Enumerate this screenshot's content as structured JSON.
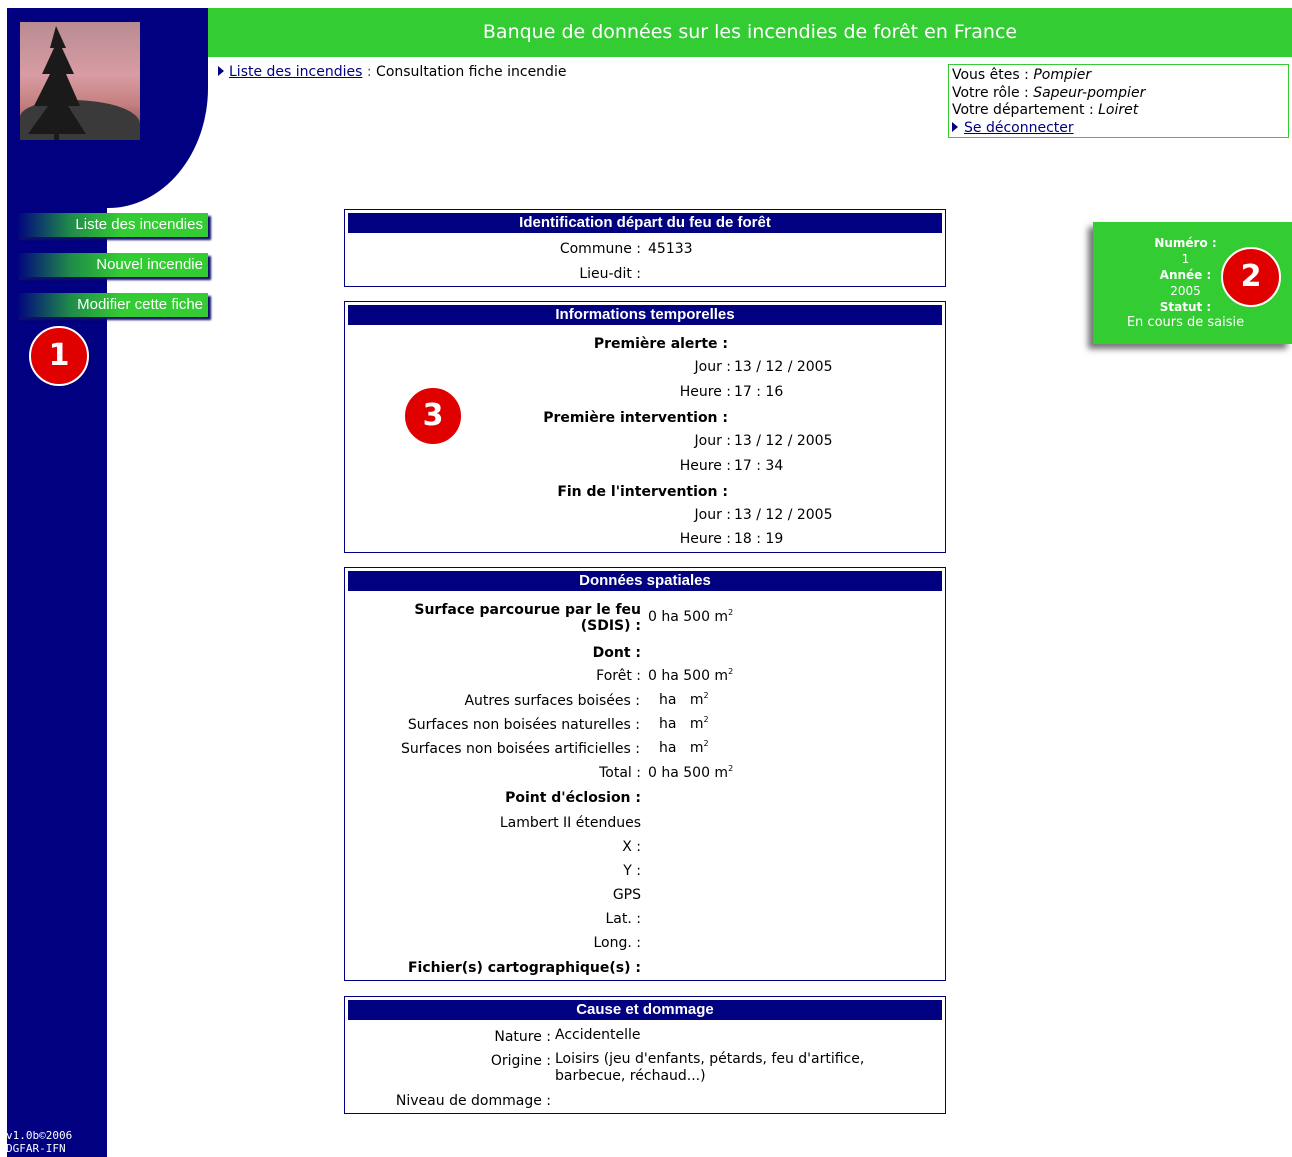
{
  "app": {
    "title": "Banque de données sur les incendies de forêt en France",
    "version": "v1.0b©2006",
    "org": "DGFAR-IFN"
  },
  "breadcrumb": {
    "link": "Liste des incendies",
    "separator": ":",
    "current": "Consultation fiche incendie"
  },
  "user": {
    "label_vous": "Vous êtes :",
    "vous": "Pompier",
    "label_role": "Votre rôle :",
    "role": "Sapeur-pompier",
    "label_dept": "Votre département :",
    "dept": "Loiret",
    "logout": "Se déconnecter"
  },
  "menu": [
    {
      "label": "Liste des incendies"
    },
    {
      "label": "Nouvel incendie"
    },
    {
      "label": "Modifier cette fiche"
    }
  ],
  "badges": [
    "1",
    "2",
    "3"
  ],
  "status": {
    "numero_label": "Numéro :",
    "numero": "1",
    "annee_label": "Année :",
    "annee": "2005",
    "statut_label": "Statut :",
    "statut": "En cours de saisie"
  },
  "identification": {
    "title": "Identification départ du feu de forêt",
    "commune_label": "Commune :",
    "commune": "45133",
    "lieudit_label": "Lieu-dit :",
    "lieudit": ""
  },
  "temporelles": {
    "title": "Informations temporelles",
    "jour_label": "Jour :",
    "heure_label": "Heure :",
    "blocks": [
      {
        "heading": "Première alerte :",
        "jour": "13 / 12 / 2005",
        "heure": "17 : 16"
      },
      {
        "heading": "Première intervention :",
        "jour": "13 / 12 / 2005",
        "heure": "17 : 34"
      },
      {
        "heading": "Fin de l'intervention :",
        "jour": "13 / 12 / 2005",
        "heure": "18 : 19"
      }
    ]
  },
  "spatiales": {
    "title": "Données spatiales",
    "surface_label_1": "Surface parcourue par le feu",
    "surface_label_2": "(SDIS) :",
    "surface_value": "0 ha 500 m",
    "sup": "2",
    "dont": "Dont :",
    "foret_label": "Forêt :",
    "foret_value": "0 ha 500 m",
    "autres_label": "Autres surfaces boisées :",
    "non_nat_label": "Surfaces non boisées naturelles :",
    "non_art_label": "Surfaces non boisées artificielles :",
    "ha": "ha",
    "m": "m",
    "total_label": "Total :",
    "total_value": "0 ha 500 m",
    "eclosion_label": "Point d'éclosion :",
    "lambert_label": "Lambert II étendues",
    "x_label": "X :",
    "y_label": "Y :",
    "gps_label": "GPS",
    "lat_label": "Lat. :",
    "long_label": "Long. :",
    "fichiers_label": "Fichier(s) cartographique(s) :"
  },
  "cause": {
    "title": "Cause et dommage",
    "nature_label": "Nature :",
    "nature": "Accidentelle",
    "origine_label": "Origine :",
    "origine_1": "Loisirs (jeu d'enfants, pétards, feu d'artifice,",
    "origine_2": "barbecue, réchaud...)",
    "niveau_label": "Niveau de dommage :",
    "niveau": ""
  }
}
